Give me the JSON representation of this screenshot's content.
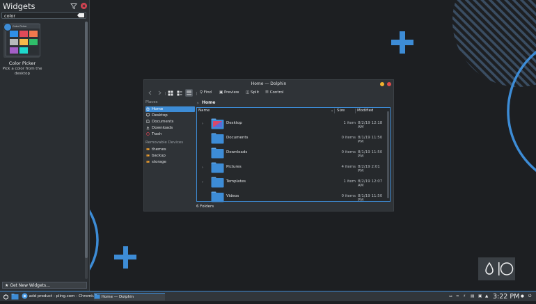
{
  "widgets_panel": {
    "title": "Widgets",
    "search_value": "color",
    "widget": {
      "thumb_label": "Color Picker",
      "name": "Color Picker",
      "description": "Pick a color from the desktop"
    },
    "get_new_label": "Get New Widgets..."
  },
  "dolphin": {
    "title": "Home — Dolphin",
    "toolbar": {
      "find": "Find",
      "preview": "Preview",
      "split": "Split",
      "control": "Control"
    },
    "places_header": "Places",
    "places": [
      {
        "label": "Home",
        "icon": "home-icon",
        "active": true
      },
      {
        "label": "Desktop",
        "icon": "desktop-icon",
        "active": false
      },
      {
        "label": "Documents",
        "icon": "documents-icon",
        "active": false
      },
      {
        "label": "Downloads",
        "icon": "downloads-icon",
        "active": false
      },
      {
        "label": "Trash",
        "icon": "trash-icon",
        "active": false
      }
    ],
    "devices_header": "Removable Devices",
    "devices": [
      {
        "label": "themes",
        "icon": "drive-icon"
      },
      {
        "label": "backup",
        "icon": "drive-icon"
      },
      {
        "label": "storage",
        "icon": "drive-icon"
      }
    ],
    "breadcrumb": "Home",
    "columns": {
      "name": "Name",
      "size": "Size",
      "modified": "Modified"
    },
    "rows": [
      {
        "name": "Desktop",
        "size": "1 item",
        "modified": "8/2/19 12:18 AM",
        "expandable": true
      },
      {
        "name": "Documents",
        "size": "0 items",
        "modified": "8/1/19 11:50 PM",
        "expandable": false
      },
      {
        "name": "Downloads",
        "size": "0 items",
        "modified": "8/1/19 11:50 PM",
        "expandable": false
      },
      {
        "name": "Pictures",
        "size": "4 items",
        "modified": "8/2/19 2:01 PM",
        "expandable": true
      },
      {
        "name": "Templates",
        "size": "1 item",
        "modified": "8/2/19 12:07 AM",
        "expandable": true
      },
      {
        "name": "Videos",
        "size": "0 items",
        "modified": "8/1/19 11:50 PM",
        "expandable": false
      }
    ],
    "status": "6 Folders"
  },
  "taskbar": {
    "tasks": [
      "add product - pling.com - Chromiu...",
      "Home — Dolphin"
    ],
    "clock": "3:22 PM"
  },
  "colors": {
    "accent": "#3d8cd6",
    "panel": "#2a2e32",
    "close": "#da4453"
  }
}
